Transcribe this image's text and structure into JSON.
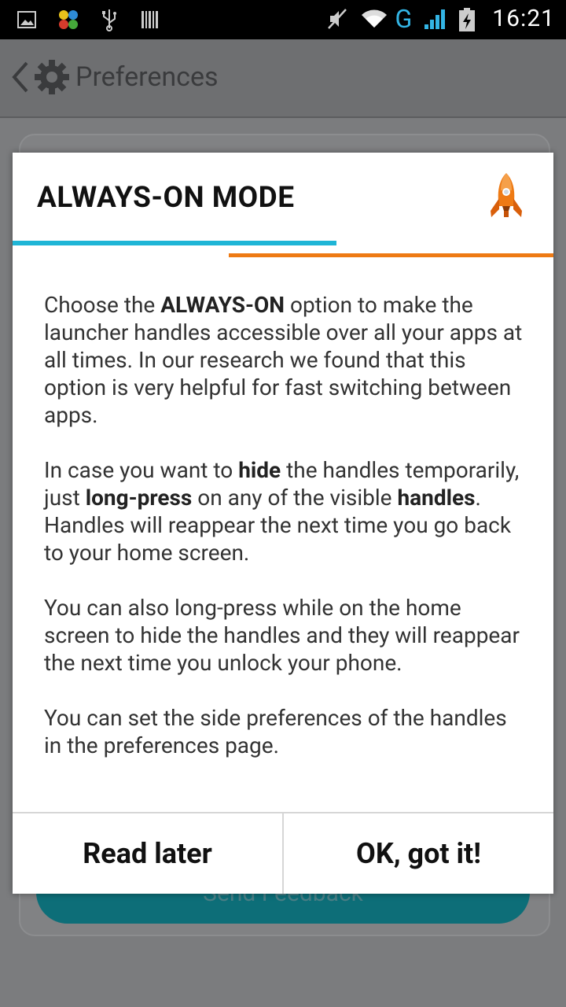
{
  "status_bar": {
    "time": "16:21",
    "network": "G"
  },
  "app": {
    "title": "Preferences",
    "background_button_label": "Send Feedback"
  },
  "dialog": {
    "title": "ALWAYS-ON MODE",
    "paragraphs": [
      {
        "parts": [
          "Choose the ",
          "ALWAYS-ON",
          " option to make the launcher handles accessible over all your apps at all times. In our research we found that this option is very helpful for fast switching between apps."
        ]
      },
      {
        "parts": [
          "In case you want to ",
          "hide",
          " the handles temporarily, just ",
          "long-press",
          " on any of the visible ",
          "handles",
          ". Handles will reappear the next time you go back to your home screen."
        ]
      },
      {
        "parts": [
          "You can also long-press while on the home screen to hide the handles and they will reappear the next time you unlock your phone."
        ]
      },
      {
        "parts": [
          "You can set the side preferences of the handles in the preferences page."
        ]
      }
    ],
    "buttons": {
      "read_later": "Read later",
      "ok": "OK, got it!"
    },
    "colors": {
      "accent_blue": "#1fb5d6",
      "accent_orange": "#ee7a14"
    }
  }
}
